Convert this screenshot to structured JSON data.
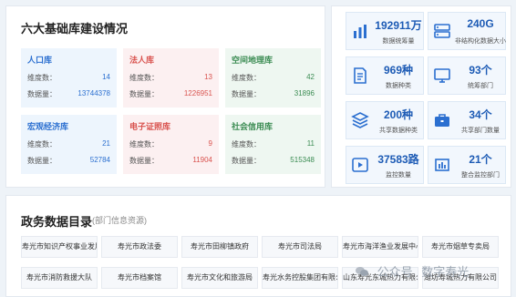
{
  "overview": {
    "title": "六大基础库建设情况",
    "labels": {
      "dim": "维度数：",
      "count": "数据量："
    },
    "libraries": [
      {
        "name": "人口库",
        "dim": "14",
        "count": "13744378",
        "theme": "blue"
      },
      {
        "name": "法人库",
        "dim": "13",
        "count": "1226951",
        "theme": "red"
      },
      {
        "name": "空间地理库",
        "dim": "42",
        "count": "31896",
        "theme": "green"
      },
      {
        "name": "宏观经济库",
        "dim": "21",
        "count": "52784",
        "theme": "blue"
      },
      {
        "name": "电子证照库",
        "dim": "9",
        "count": "11904",
        "theme": "red"
      },
      {
        "name": "社会信用库",
        "dim": "11",
        "count": "515348",
        "theme": "green"
      }
    ]
  },
  "stats": [
    {
      "value": "192911万",
      "label": "数据统筹量",
      "icon": "database-bars-icon"
    },
    {
      "value": "240G",
      "label": "非结构化数据大小",
      "icon": "server-icon"
    },
    {
      "value": "969种",
      "label": "数据种类",
      "icon": "document-icon"
    },
    {
      "value": "93个",
      "label": "统筹部门",
      "icon": "monitor-icon"
    },
    {
      "value": "200种",
      "label": "共享数据种类",
      "icon": "layers-icon"
    },
    {
      "value": "34个",
      "label": "共享部门数量",
      "icon": "briefcase-icon"
    },
    {
      "value": "37583路",
      "label": "监控数量",
      "icon": "video-icon"
    },
    {
      "value": "21个",
      "label": "整合监控部门",
      "icon": "bar-chart-icon"
    }
  ],
  "catalog": {
    "title": "政务数据目录",
    "subtitle": "(部门信息资源)",
    "departments_row1": [
      "寿光市知识产权事业发展",
      "寿光市政法委",
      "寿光市田柳镇政府",
      "寿光市司法局",
      "寿光市海洋渔业发展中心",
      "寿光市烟草专卖局"
    ],
    "departments_row2": [
      "寿光市消防救援大队",
      "寿光市档案馆",
      "寿光市文化和旅游局",
      "寿光水务控股集团有限公司",
      "山东寿光东城热力有限公司",
      "潍坊寿城热力有限公司"
    ]
  },
  "watermark": {
    "prefix": "公众号",
    "name": "数字寿光"
  },
  "colors": {
    "blue": "#2b6fd0",
    "red": "#d9534f",
    "green": "#3b8c53",
    "stat_value": "#1d5bb5"
  }
}
